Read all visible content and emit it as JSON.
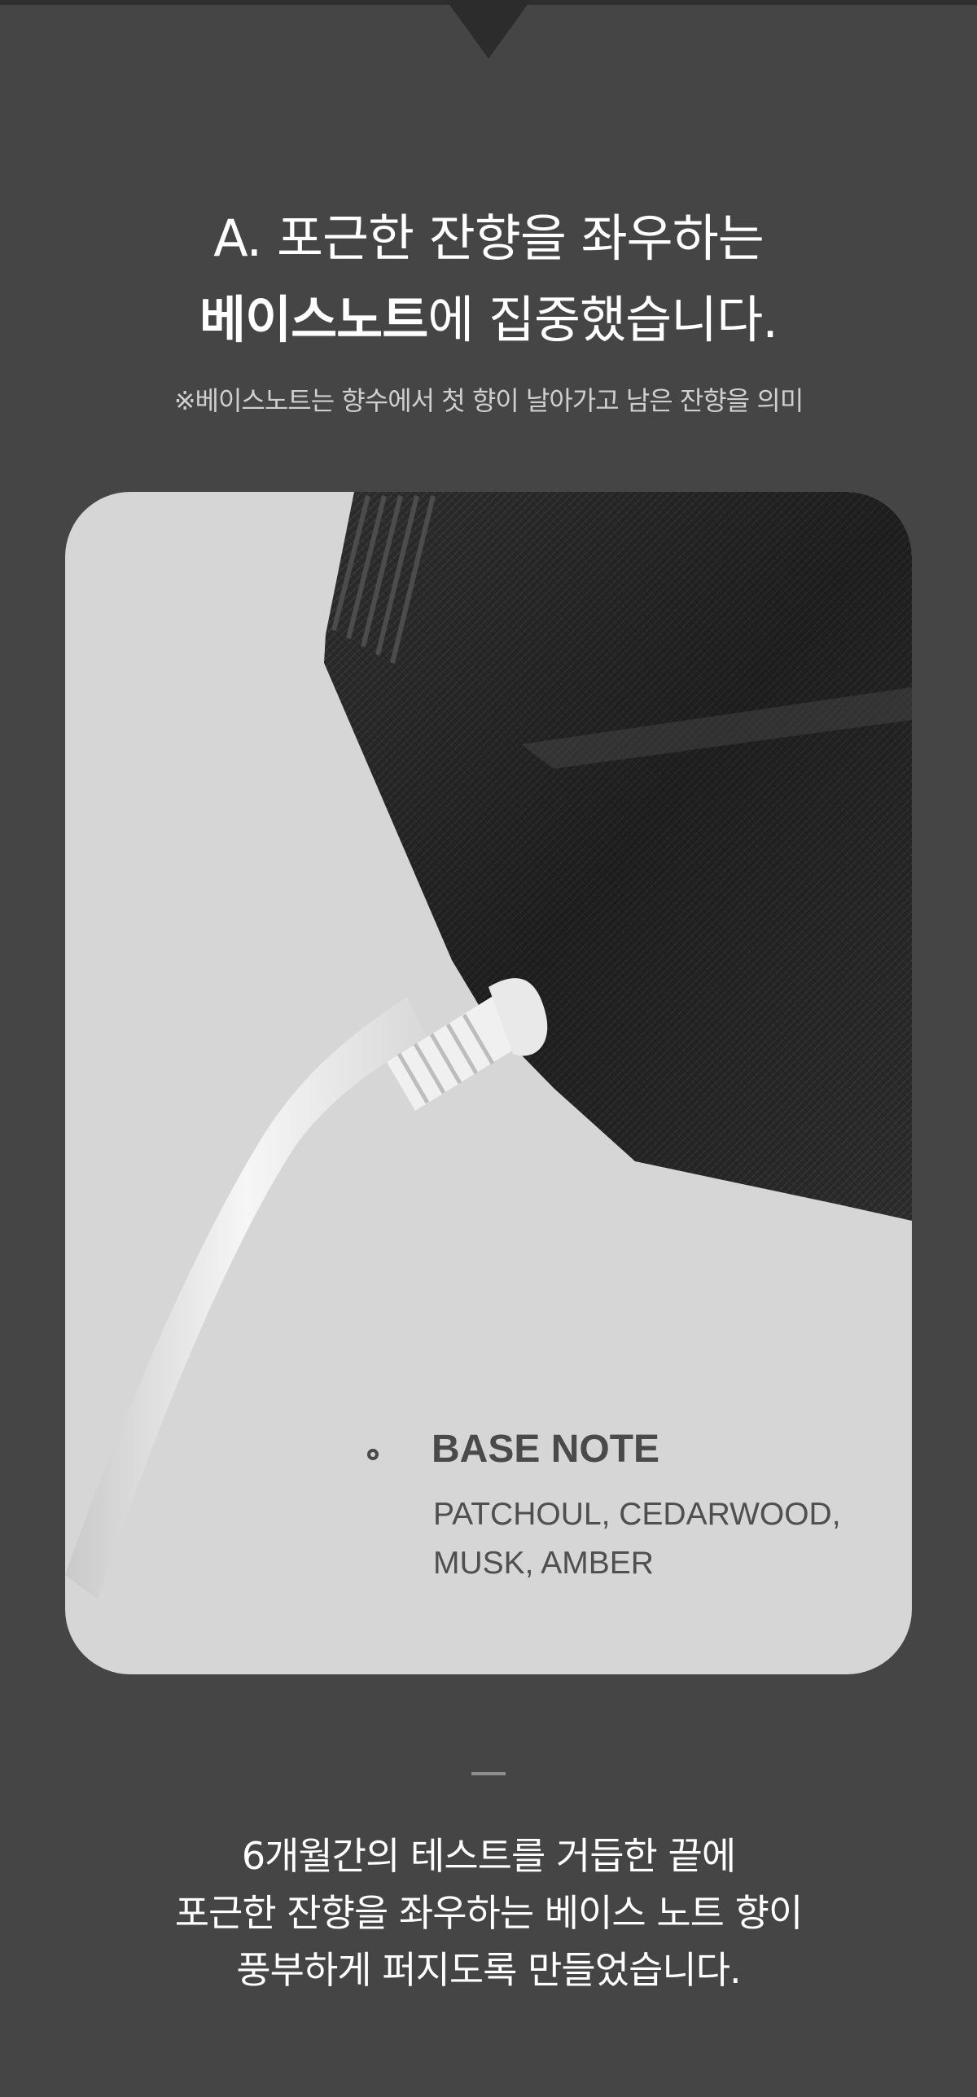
{
  "heading": {
    "line1": "A. 포근한 잔향을 좌우하는",
    "line2_strong": "베이스노트",
    "line2_rest": "에 집중했습니다."
  },
  "footnote": "※베이스노트는 향수에서 첫 향이 날아가고 남은 잔향을 의미",
  "card": {
    "note_title": "BASE NOTE",
    "note_ingredients_line1": "PATCHOUL, CEDARWOOD,",
    "note_ingredients_line2": "MUSK, AMBER"
  },
  "description": {
    "line1": "6개월간의 테스트를 거듭한 끝에",
    "line2": "포근한 잔향을 좌우하는 베이스 노트 향이",
    "line3": "풍부하게 퍼지도록 만들었습니다."
  }
}
